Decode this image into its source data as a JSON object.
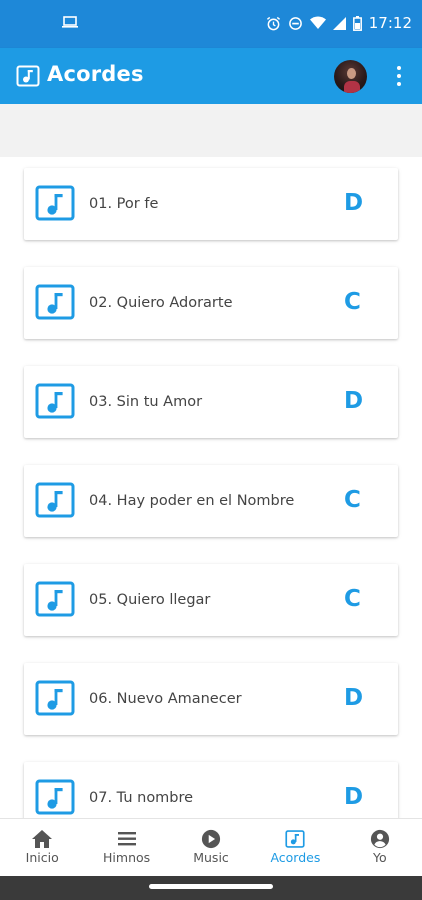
{
  "status_bar": {
    "time": "17:12",
    "left_icon": "laptop-icon",
    "right_icons": [
      "alarm-icon",
      "do-not-disturb-icon",
      "wifi-icon",
      "signal-icon",
      "battery-icon"
    ]
  },
  "app_bar": {
    "title": "Acordes",
    "logo_icon": "music-note-icon",
    "menu_icon": "more-vert-icon"
  },
  "songs": [
    {
      "title": "01. Por fe",
      "key": "D"
    },
    {
      "title": "02. Quiero Adorarte",
      "key": "C"
    },
    {
      "title": "03. Sin tu Amor",
      "key": "D"
    },
    {
      "title": "04. Hay poder en el Nombre",
      "key": "C"
    },
    {
      "title": "05. Quiero llegar",
      "key": "C"
    },
    {
      "title": "06. Nuevo Amanecer",
      "key": "D"
    },
    {
      "title": "07. Tu nombre",
      "key": "D"
    }
  ],
  "bottom_nav": [
    {
      "label": "Inicio",
      "icon": "home-icon",
      "active": false
    },
    {
      "label": "Himnos",
      "icon": "list-icon",
      "active": false
    },
    {
      "label": "Music",
      "icon": "play-circle-icon",
      "active": false
    },
    {
      "label": "Acordes",
      "icon": "music-note-icon",
      "active": true
    },
    {
      "label": "Yo",
      "icon": "account-circle-icon",
      "active": false
    }
  ],
  "colors": {
    "status_bar": "#1e88d8",
    "app_bar": "#1e9be4",
    "accent": "#1e9be4",
    "text": "#444444",
    "gesture_bar": "#3a3a3a"
  }
}
